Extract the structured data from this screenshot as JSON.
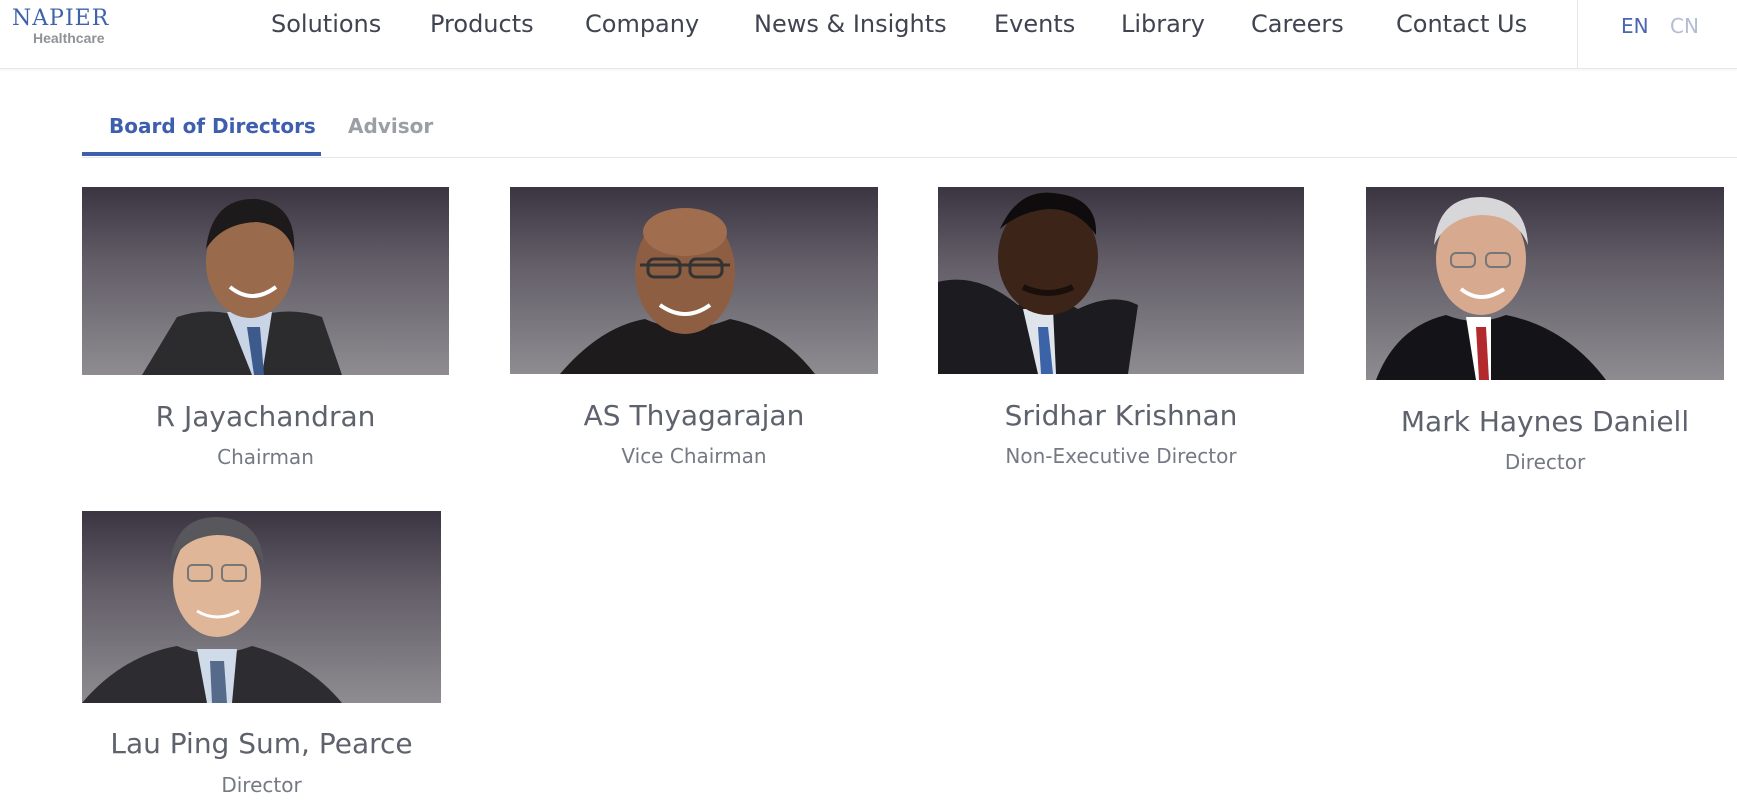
{
  "logo": {
    "line1": "NAPIER",
    "line2": "Healthcare"
  },
  "nav": {
    "items": [
      "Solutions",
      "Products",
      "Company",
      "News & Insights",
      "Events",
      "Library",
      "Careers",
      "Contact Us"
    ],
    "languages": [
      "EN",
      "CN"
    ],
    "active_language": "EN"
  },
  "tabs": {
    "items": [
      "Board of Directors",
      "Advisor"
    ],
    "active": "Board of Directors"
  },
  "directors": [
    {
      "name": "R Jayachandran",
      "role": "Chairman"
    },
    {
      "name": "AS Thyagarajan",
      "role": "Vice Chairman"
    },
    {
      "name": "Sridhar Krishnan",
      "role": "Non-Executive Director"
    },
    {
      "name": "Mark Haynes Daniell",
      "role": "Director"
    },
    {
      "name": "Lau Ping Sum, Pearce",
      "role": "Director"
    }
  ],
  "colors": {
    "brand_blue": "#3e5fae",
    "nav_text": "#3f4450",
    "muted_text": "#747983"
  }
}
